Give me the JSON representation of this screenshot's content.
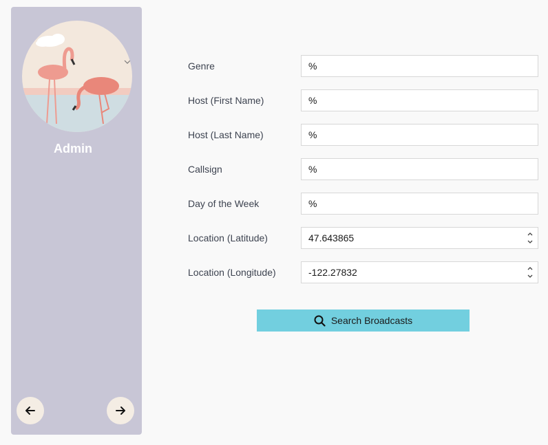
{
  "sidebar": {
    "user_name": "Admin",
    "avatar": "flamingo-illustration",
    "prev_icon": "arrow-left-icon",
    "next_icon": "arrow-right-icon"
  },
  "form": {
    "fields": [
      {
        "label": "Genre",
        "value": "%"
      },
      {
        "label": "Host (First Name)",
        "value": "%"
      },
      {
        "label": "Host (Last Name)",
        "value": "%"
      },
      {
        "label": "Callsign",
        "value": "%"
      },
      {
        "label": "Day of the Week",
        "value": "%"
      },
      {
        "label": "Location (Latitude)",
        "value": "47.643865"
      },
      {
        "label": "Location (Longitude)",
        "value": "-122.27832"
      }
    ],
    "search_label": "Search Broadcasts",
    "search_icon": "search-icon"
  },
  "colors": {
    "sidebar_bg": "#c8c6d6",
    "button_bg": "#72cfdf",
    "nav_button_bg": "#f4ede4",
    "page_bg": "#f9f9f9"
  }
}
